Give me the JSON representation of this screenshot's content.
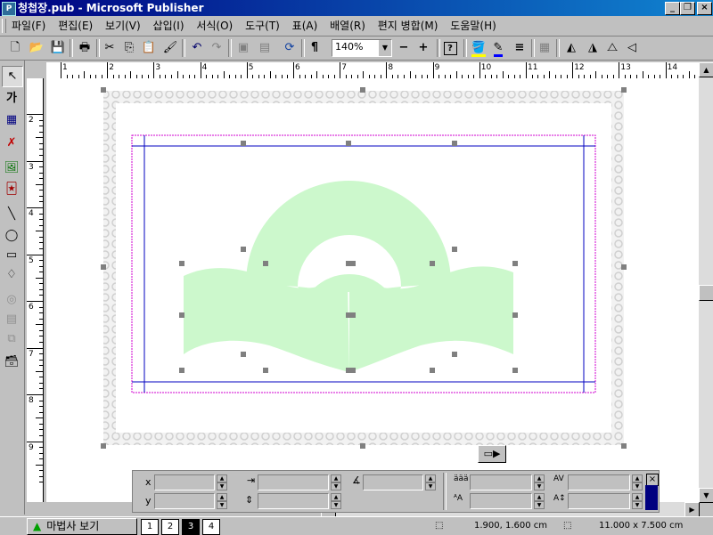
{
  "window": {
    "title": "청첩장.pub - Microsoft Publisher",
    "app_icon": "publisher-icon",
    "controls": [
      "_",
      "❐",
      "×"
    ]
  },
  "menu": [
    {
      "label": "파일(F)"
    },
    {
      "label": "편집(E)"
    },
    {
      "label": "보기(V)"
    },
    {
      "label": "삽입(I)"
    },
    {
      "label": "서식(O)"
    },
    {
      "label": "도구(T)"
    },
    {
      "label": "표(A)"
    },
    {
      "label": "배열(R)"
    },
    {
      "label": "편지 병합(M)"
    },
    {
      "label": "도움말(H)"
    }
  ],
  "toolbar": {
    "zoom_value": "140%",
    "zoom_out": "−",
    "zoom_in": "+"
  },
  "ruler": {
    "h_labels": [
      "1",
      "2",
      "3",
      "4",
      "5",
      "6",
      "7",
      "8",
      "9",
      "10",
      "11",
      "12",
      "13",
      "14"
    ],
    "v_labels": [
      "2",
      "3",
      "4",
      "5",
      "6",
      "7",
      "8",
      "9"
    ]
  },
  "measure": {
    "x_label": "x",
    "y_label": "y",
    "x_value": "",
    "y_value": ""
  },
  "status": {
    "wizard_label": "마법사 보기",
    "pages": [
      "1",
      "2",
      "3",
      "4"
    ],
    "current_page": "3",
    "position": "1.900, 1.600 cm",
    "size": "11.000 x  7.500 cm"
  },
  "colors": {
    "shape_fill": "#ccf8cc",
    "border_art": "#e4e4e4",
    "guide_blue": "#0000c0",
    "margin_pink": "#d000d0"
  }
}
